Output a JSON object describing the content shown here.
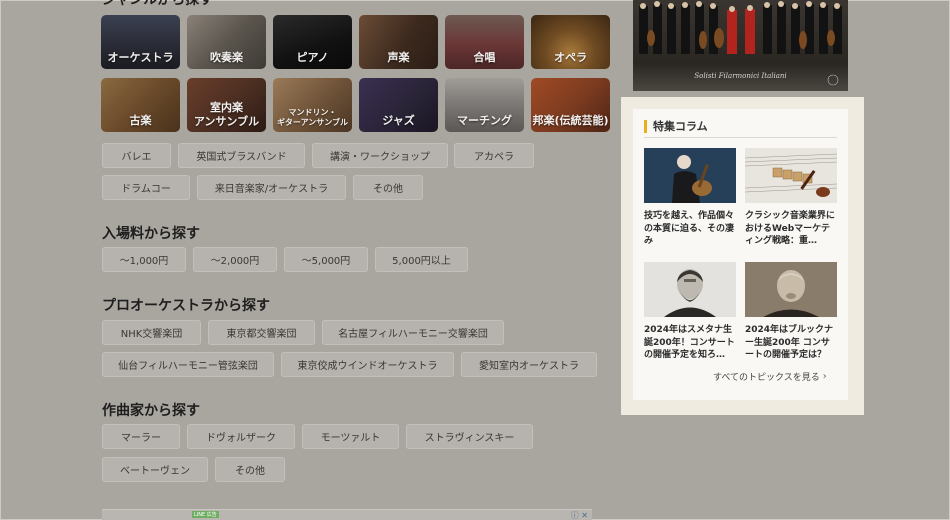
{
  "genre_section": {
    "heading": "ジャンルから探す",
    "tiles": [
      {
        "label": "オーケストラ",
        "color": "#2f3340"
      },
      {
        "label": "吹奏楽",
        "color": "#5c5650"
      },
      {
        "label": "ピアノ",
        "color": "#1c1a1a"
      },
      {
        "label": "声楽",
        "color": "#4a3628"
      },
      {
        "label": "合唱",
        "color": "#5b3a38"
      },
      {
        "label": "オペラ",
        "color": "#6a4a28"
      },
      {
        "label": "古楽",
        "color": "#6a4a2a"
      },
      {
        "label": "室内楽\nアンサンブル",
        "color": "#4b2e22"
      },
      {
        "label": "マンドリン・\nギターアンサンブル",
        "color": "#6e5238"
      },
      {
        "label": "ジャズ",
        "color": "#2a2438"
      },
      {
        "label": "マーチング",
        "color": "#7a7774"
      },
      {
        "label": "邦楽(伝統芸能)",
        "color": "#7a3a20"
      }
    ],
    "chips_row1": [
      "バレエ",
      "英国式ブラスバンド",
      "講演・ワークショップ",
      "アカペラ"
    ],
    "chips_row2": [
      "ドラムコー",
      "来日音楽家/オーケストラ",
      "その他"
    ]
  },
  "price_section": {
    "heading": "入場料から探す",
    "chips": [
      "〜1,000円",
      "〜2,000円",
      "〜5,000円",
      "5,000円以上"
    ]
  },
  "orchestra_section": {
    "heading": "プロオーケストラから探す",
    "chips_row1": [
      "NHK交響楽団",
      "東京都交響楽団",
      "名古屋フィルハーモニー交響楽団"
    ],
    "chips_row2": [
      "仙台フィルハーモニー管弦楽団",
      "東京佼成ウインドオーケストラ",
      "愛知室内オーケストラ"
    ]
  },
  "composer_section": {
    "heading": "作曲家から探す",
    "chips_row1": [
      "マーラー",
      "ドヴォルザーク",
      "モーツァルト",
      "ストラヴィンスキー"
    ],
    "chips_row2": [
      "ベートーヴェン",
      "その他"
    ]
  },
  "sidebar": {
    "hero_caption": "Solisti Filarmonici Italiani",
    "feature": {
      "title": "特集コラム",
      "accent": "#e8b01f",
      "cards": [
        {
          "title": "技巧を越え、作品個々の本質に迫る、その凄み"
        },
        {
          "title": "クラシック音楽業界におけるWebマーケティング戦略：重…"
        },
        {
          "title": "2024年はスメタナ生誕200年！コンサートの開催予定を知ろ…"
        },
        {
          "title": "2024年はブルックナー生誕200年 コンサートの開催予定は？"
        }
      ],
      "more_label": "すべてのトピックスを見る"
    }
  },
  "ad": {
    "badge": "LINE 広告"
  }
}
